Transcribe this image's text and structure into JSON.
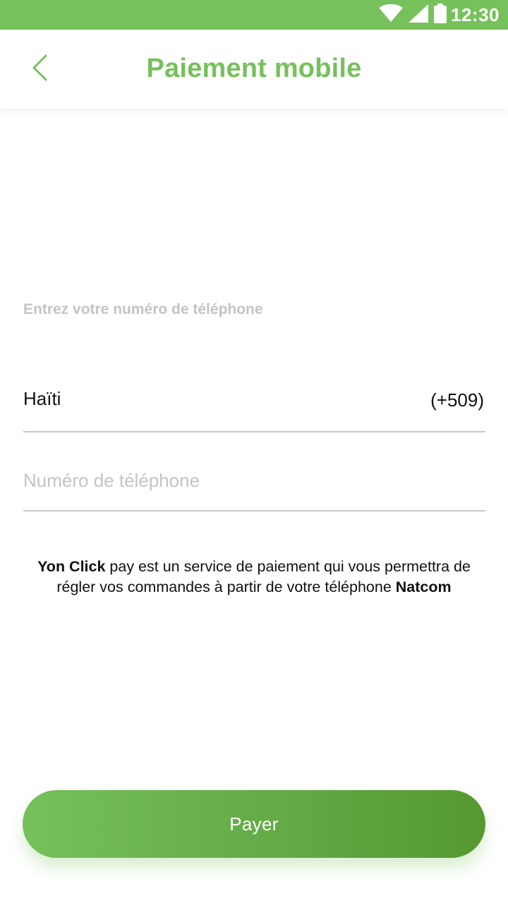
{
  "status_bar": {
    "time": "12:30",
    "icons": [
      "wifi-icon",
      "signal-icon",
      "battery-icon"
    ],
    "background_color": "#76c15b"
  },
  "header": {
    "title": "Paiement mobile",
    "back_icon": "chevron-left-icon",
    "accent_color": "#76c15b"
  },
  "form": {
    "section_label": "Entrez votre numéro de téléphone",
    "country": {
      "name": "Haïti",
      "dial_code": "(+509)"
    },
    "phone": {
      "value": "",
      "placeholder": "Numéro de téléphone"
    }
  },
  "info": {
    "brand": "Yon Click",
    "text_middle": " pay est un service de paiement qui vous permettra de régler vos commandes à partir de votre téléphone ",
    "operator": "Natcom"
  },
  "actions": {
    "pay_label": "Payer"
  }
}
